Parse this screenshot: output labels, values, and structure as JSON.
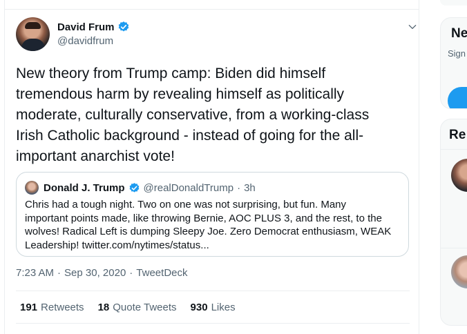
{
  "tweet": {
    "author_name": "David Frum",
    "author_handle": "@davidfrum",
    "text_lines": [
      "New theory from Trump camp: Biden did himself",
      "tremendous harm by revealing himself as  politically",
      "moderate, culturally conservative, from a working-class",
      "Irish Catholic background - instead of going for the all-",
      "important anarchist vote!"
    ],
    "time": "7:23 AM",
    "date": "Sep 30, 2020",
    "source": "TweetDeck",
    "stats": {
      "retweets_count": "191",
      "retweets_label": "Retweets",
      "quotes_count": "18",
      "quotes_label": "Quote Tweets",
      "likes_count": "930",
      "likes_label": "Likes"
    }
  },
  "quoted": {
    "author_name": "Donald J. Trump",
    "author_handle": "@realDonaldTrump",
    "separator": "·",
    "time": "3h",
    "text_lines": [
      "Chris had a tough night. Two on one was not surprising, but  fun. Many",
      "important points made, like throwing Bernie, AOC PLUS 3, and the rest, to the",
      "wolves! Radical Left is dumping Sleepy Joe. Zero Democrat enthusiasm, WEAK",
      "Leadership! twitter.com/nytimes/status..."
    ]
  },
  "meta_separator": "·",
  "sidebar": {
    "card1_title": "Ne",
    "card1_subtitle": "Sign",
    "card2_title": "Re"
  },
  "colors": {
    "verified": "#1d9bf0",
    "accent": "#1d9bf0",
    "text_primary": "#0f1419",
    "text_secondary": "#536471"
  },
  "icons": {
    "verified": "verified-badge-icon",
    "more": "chevron-down-icon"
  }
}
